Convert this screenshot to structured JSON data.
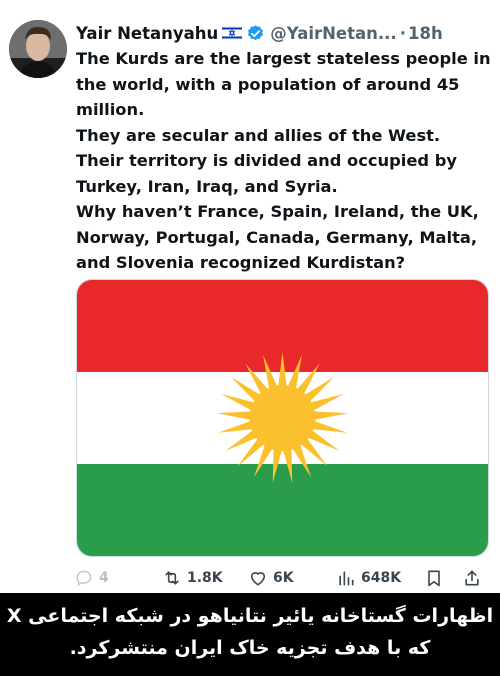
{
  "tweet": {
    "author": {
      "name": "Yair Netanyahu",
      "handle": "@YairNetan...",
      "flag_icon": "israel-flag-icon",
      "verified_icon": "verified-badge-icon"
    },
    "separator": "·",
    "timestamp": "18h",
    "text_paragraphs": [
      "The Kurds are the largest stateless people in the world, with a population of around 45 million.",
      "They are secular and allies of the West.",
      "Their territory is divided and occupied by Turkey, Iran, Iraq, and Syria.",
      "Why haven’t France, Spain, Ireland, the UK, Norway, Portugal, Canada, Germany, Malta, and Slovenia recognized Kurdistan?"
    ],
    "media": {
      "description_icon": "kurdistan-flag-image",
      "colors": {
        "red": "#e8282b",
        "white": "#ffffff",
        "green": "#2a9d4a",
        "sun": "#fbc02d"
      }
    },
    "actions": {
      "replies": "4",
      "reposts": "1.8K",
      "likes": "6K",
      "views": "648K"
    }
  },
  "caption": {
    "line1": "اظهارات گستاخانه یائیر نتانیاهو در شبکه اجتماعی X",
    "line2": "که با هدف تجزیه خاک ایران منتشرکرد."
  },
  "colors": {
    "accent": "#1d9bf0",
    "muted": "#536471",
    "text": "#0f1419",
    "caption_bg": "#000000"
  }
}
